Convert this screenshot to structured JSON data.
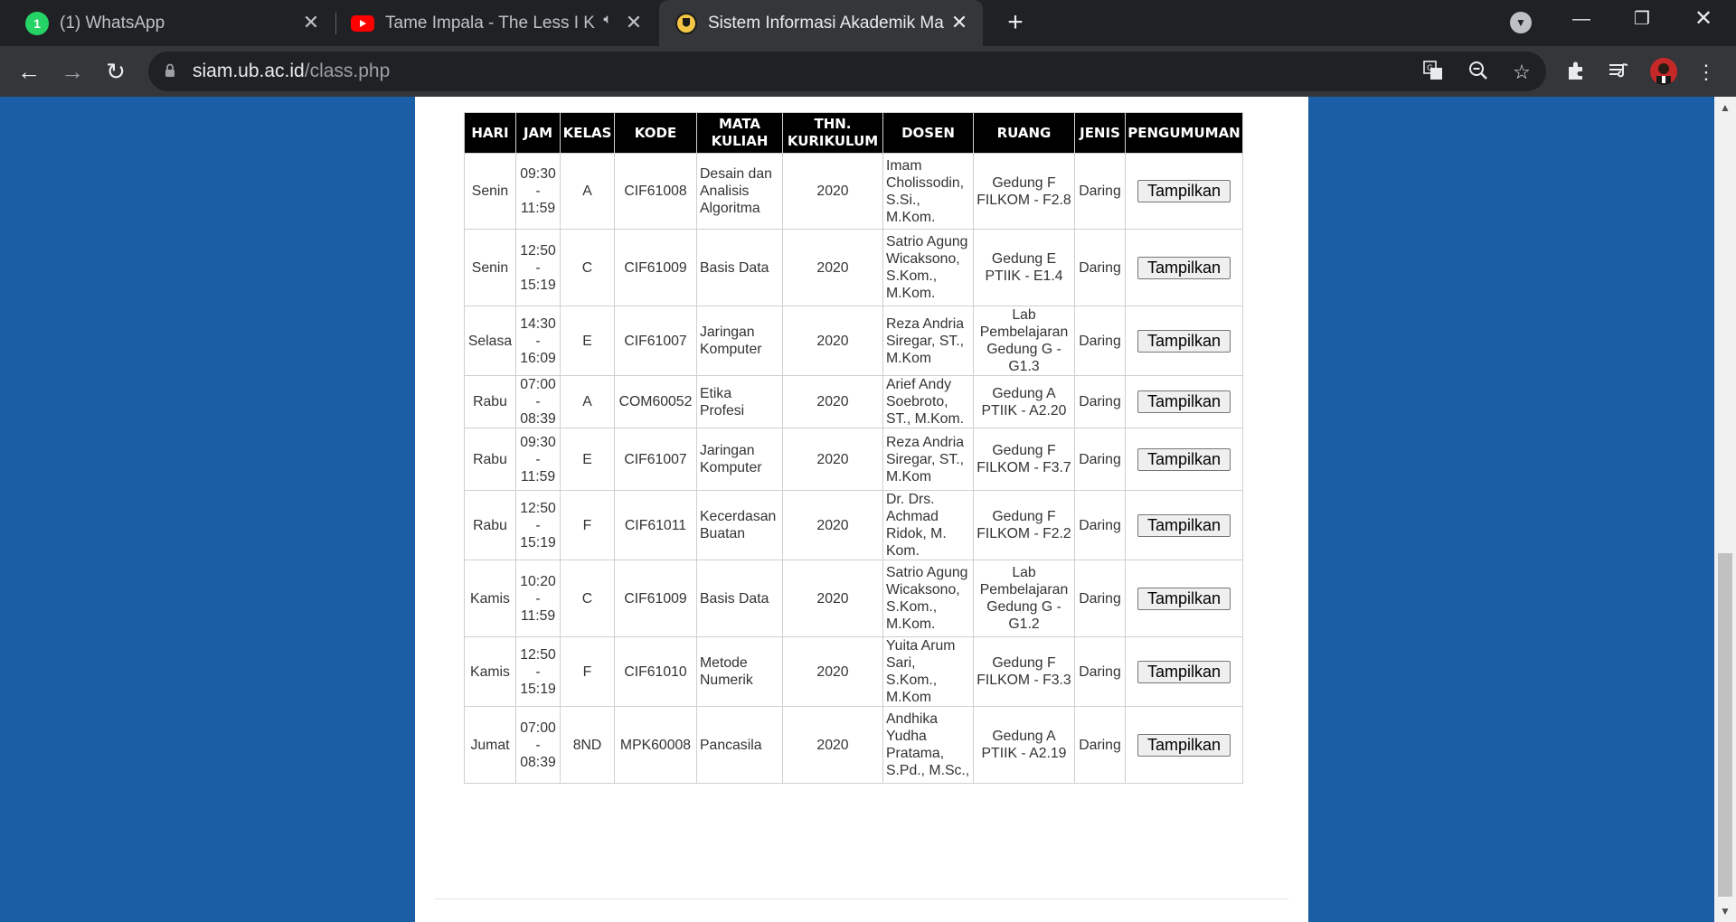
{
  "browser": {
    "tabs": [
      {
        "title": "(1) WhatsApp",
        "badge": "1",
        "favicon": "whatsapp-icon"
      },
      {
        "title": "Tame Impala - The Less I Know The Better",
        "favicon": "youtube-icon"
      },
      {
        "title": "Sistem Informasi Akademik Mahasiswa",
        "favicon": "ub-logo-icon"
      }
    ],
    "new_tab_label": "+",
    "address": {
      "host": "siam.ub.ac.id",
      "path": "/class.php"
    }
  },
  "table": {
    "headers": {
      "hari": "HARI",
      "jam": "JAM",
      "kelas": "KELAS",
      "kode": "KODE",
      "mk1": "MATA",
      "mk2": "KULIAH",
      "thn1": "THN.",
      "thn2": "KURIKULUM",
      "dosen": "DOSEN",
      "ruang": "RUANG",
      "jenis": "JENIS",
      "pengumuman": "PENGUMUMAN"
    },
    "button_label": "Tampilkan",
    "rows": [
      {
        "hari": "Senin",
        "jam_start": "09:30",
        "jam_sep": "-",
        "jam_end": "11:59",
        "kelas": "A",
        "kode": "CIF61008",
        "mk": "Desain dan Analisis Algoritma",
        "thn": "2020",
        "dosen": "Imam Cholissodin, S.Si., M.Kom.",
        "ruang": "Gedung F FILKOM - F2.8",
        "jenis": "Daring"
      },
      {
        "hari": "Senin",
        "jam_start": "12:50",
        "jam_sep": "-",
        "jam_end": "15:19",
        "kelas": "C",
        "kode": "CIF61009",
        "mk": "Basis Data",
        "thn": "2020",
        "dosen": "Satrio Agung Wicaksono, S.Kom., M.Kom.",
        "ruang": "Gedung E PTIIK - E1.4",
        "jenis": "Daring"
      },
      {
        "hari": "Selasa",
        "jam_start": "14:30",
        "jam_sep": "-",
        "jam_end": "16:09",
        "kelas": "E",
        "kode": "CIF61007",
        "mk": "Jaringan Komputer",
        "thn": "2020",
        "dosen": "Reza Andria Siregar, ST., M.Kom",
        "ruang": "Lab Pembelajaran Gedung G - G1.3",
        "jenis": "Daring"
      },
      {
        "hari": "Rabu",
        "jam_start": "07:00",
        "jam_sep": "-",
        "jam_end": "08:39",
        "kelas": "A",
        "kode": "COM60052",
        "mk": "Etika Profesi",
        "thn": "2020",
        "dosen": "Arief Andy Soebroto, ST., M.Kom.",
        "ruang": "Gedung A PTIIK - A2.20",
        "jenis": "Daring"
      },
      {
        "hari": "Rabu",
        "jam_start": "09:30",
        "jam_sep": "-",
        "jam_end": "11:59",
        "kelas": "E",
        "kode": "CIF61007",
        "mk": "Jaringan Komputer",
        "thn": "2020",
        "dosen": "Reza Andria Siregar, ST., M.Kom",
        "ruang": "Gedung F FILKOM - F3.7",
        "jenis": "Daring"
      },
      {
        "hari": "Rabu",
        "jam_start": "12:50",
        "jam_sep": "-",
        "jam_end": "15:19",
        "kelas": "F",
        "kode": "CIF61011",
        "mk": "Kecerdasan Buatan",
        "thn": "2020",
        "dosen": "Dr. Drs. Achmad Ridok, M. Kom.",
        "ruang": "Gedung F FILKOM - F2.2",
        "jenis": "Daring"
      },
      {
        "hari": "Kamis",
        "jam_start": "10:20",
        "jam_sep": "-",
        "jam_end": "11:59",
        "kelas": "C",
        "kode": "CIF61009",
        "mk": "Basis Data",
        "thn": "2020",
        "dosen": "Satrio Agung Wicaksono, S.Kom., M.Kom.",
        "ruang": "Lab Pembelajaran Gedung G - G1.2",
        "jenis": "Daring"
      },
      {
        "hari": "Kamis",
        "jam_start": "12:50",
        "jam_sep": "-",
        "jam_end": "15:19",
        "kelas": "F",
        "kode": "CIF61010",
        "mk": "Metode Numerik",
        "thn": "2020",
        "dosen": "Yuita Arum Sari, S.Kom., M.Kom",
        "ruang": "Gedung F FILKOM - F3.3",
        "jenis": "Daring"
      },
      {
        "hari": "Jumat",
        "jam_start": "07:00",
        "jam_sep": "-",
        "jam_end": "08:39",
        "kelas": "8ND",
        "kode": "MPK60008",
        "mk": "Pancasila",
        "thn": "2020",
        "dosen": "Andhika Yudha Pratama, S.Pd., M.Sc.,",
        "ruang": "Gedung A PTIIK - A2.19",
        "jenis": "Daring"
      }
    ]
  },
  "colors": {
    "page_background": "#1c5ea6",
    "header_background": "#000000",
    "titlebar": "#202124",
    "toolbar": "#35363a"
  }
}
